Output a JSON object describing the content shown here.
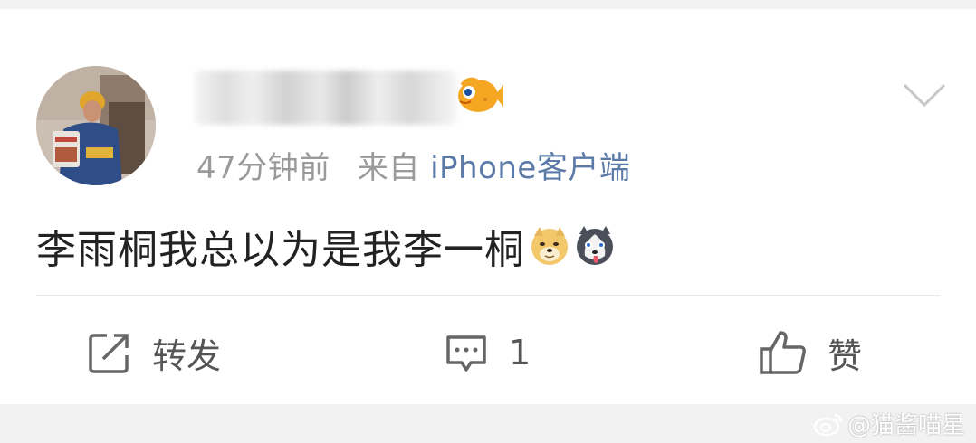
{
  "post": {
    "time": "47分钟前",
    "from": "来自",
    "source": "iPhone客户端",
    "content": "李雨桐我总以为是我李一桐"
  },
  "actions": {
    "repost_label": "转发",
    "comment_count": "1",
    "like_label": "赞"
  },
  "watermark": {
    "text": "@猫酱喵星"
  },
  "icons": [
    "avatar",
    "fish-badge-icon",
    "chevron-down-icon",
    "doge-emoji-icon",
    "husky-emoji-icon",
    "repost-icon",
    "comment-icon",
    "like-icon",
    "weibo-logo-icon"
  ],
  "colors": {
    "source_link": "#5b7aa8",
    "meta_text": "#9a9a9a",
    "body_text": "#222222"
  }
}
